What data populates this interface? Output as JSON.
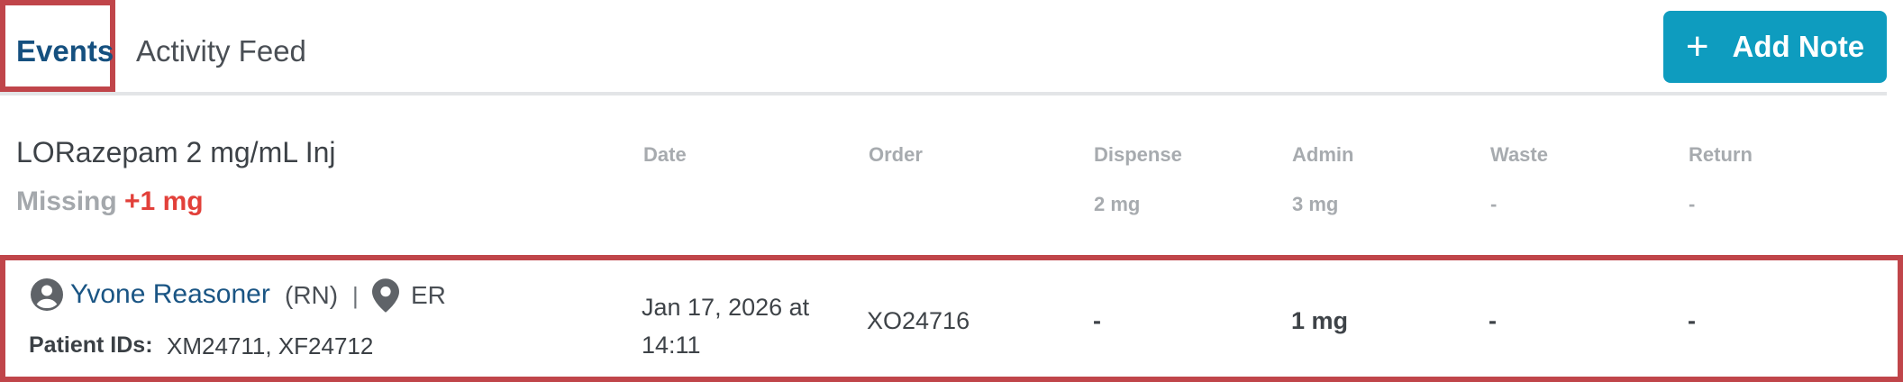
{
  "tabs": {
    "events_label": "Events",
    "activity_label": "Activity Feed"
  },
  "toolbar": {
    "add_note_label": "Add Note",
    "add_note_icon": "plus-icon"
  },
  "summary": {
    "drug_name": "LORazepam 2 mg/mL Inj",
    "missing_label": "Missing",
    "missing_delta": "+1 mg"
  },
  "columns": {
    "date": "Date",
    "order": "Order",
    "dispense": "Dispense",
    "admin": "Admin",
    "waste": "Waste",
    "return": "Return"
  },
  "totals": {
    "dispense": "2 mg",
    "admin": "3 mg",
    "waste": "-",
    "return": "-"
  },
  "event": {
    "user_name": "Yvone Reasoner",
    "user_role": "(RN)",
    "separator": "|",
    "location": "ER",
    "patient_ids_label": "Patient IDs:",
    "patient_ids": "XM24711, XF24712",
    "date": "Jan 17, 2026 at 14:11",
    "order": "XO24716",
    "dispense": "-",
    "admin": "1 mg",
    "waste": "-",
    "return": "-"
  },
  "colors": {
    "accent": "#0e9cbf",
    "highlight_border": "#c0454a",
    "link_blue": "#1a5584",
    "missing_red": "#e2403a"
  }
}
